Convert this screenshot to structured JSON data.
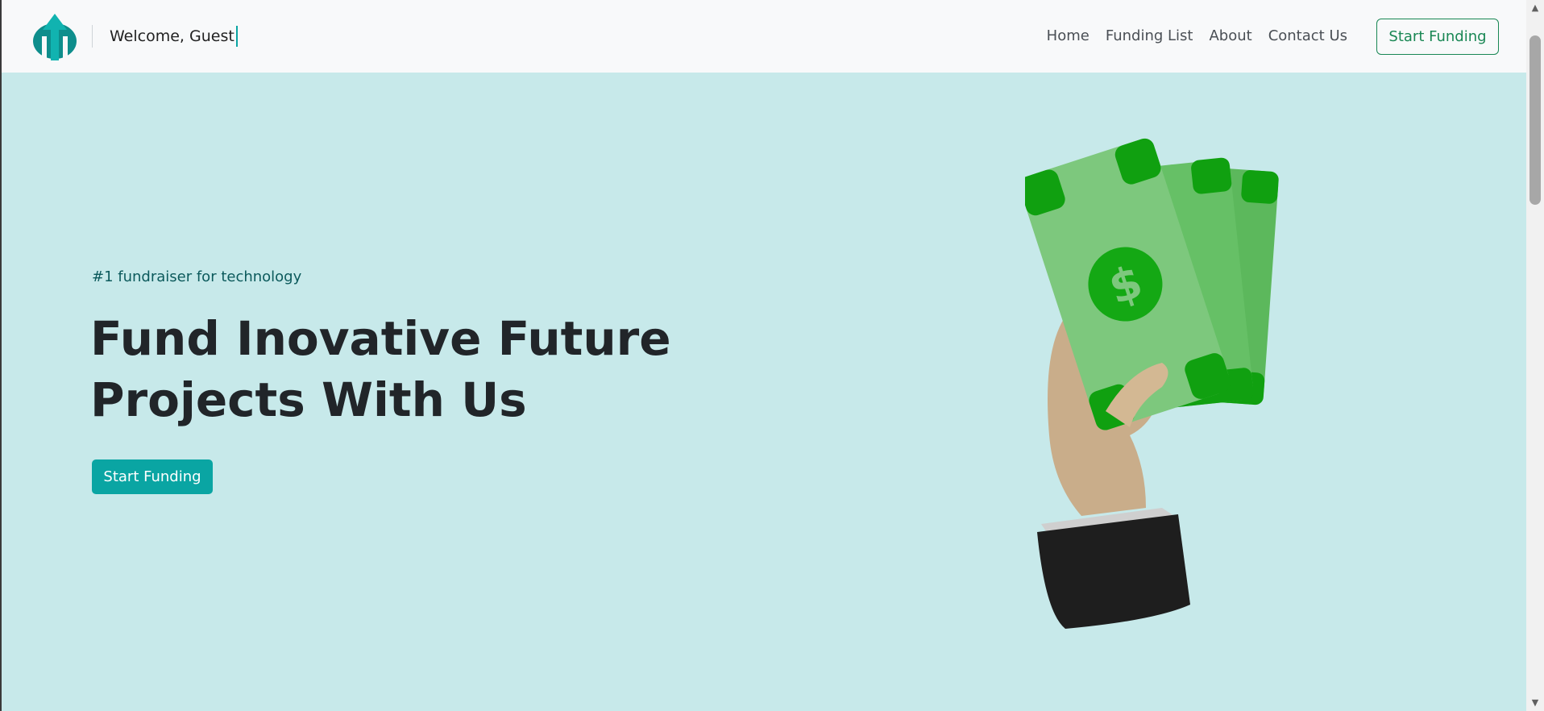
{
  "navbar": {
    "welcome_text": "Welcome, Guest",
    "links": [
      "Home",
      "Funding List",
      "About",
      "Contact Us"
    ],
    "cta_label": "Start Funding"
  },
  "hero": {
    "eyebrow": "#1 fundraiser for technology",
    "title_line1": "Fund Inovative Future",
    "title_line2": "Projects With Us",
    "cta_label": "Start Funding",
    "illustration_icon": "hand-holding-money-icon"
  },
  "colors": {
    "background": "#c7e9ea",
    "navbar": "#f8f9fa",
    "accent_teal": "#0aa5a3",
    "outline_green": "#198754",
    "money_green": "#5fbf5f"
  },
  "scrollbar": {
    "up_icon": "▲",
    "down_icon": "▼"
  }
}
